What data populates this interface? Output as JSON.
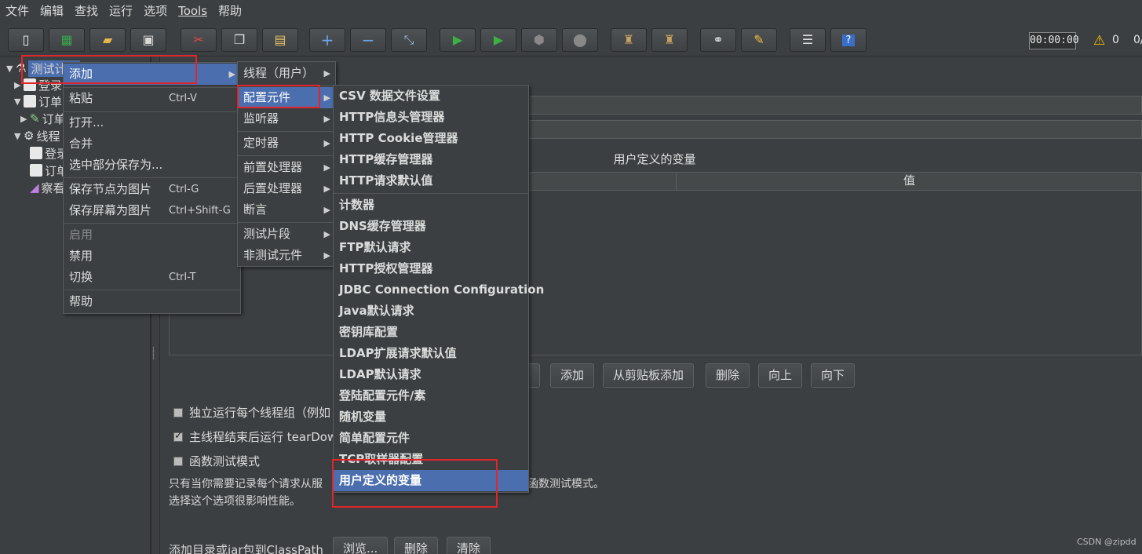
{
  "menubar": [
    "文件",
    "编辑",
    "查找",
    "运行",
    "选项",
    "Tools",
    "帮助"
  ],
  "toolbar": {
    "timer": "00:00:00",
    "warnings": "0",
    "threads": "0/"
  },
  "tree": {
    "root": "测试计划",
    "items": [
      "登录",
      "订单",
      "订单",
      "线程",
      "登录",
      "订单",
      "察看"
    ]
  },
  "context_menu": {
    "items": [
      {
        "label": "添加",
        "submenu": true
      },
      {
        "label": "粘贴",
        "shortcut": "Ctrl-V"
      },
      {
        "label": "打开..."
      },
      {
        "label": "合并"
      },
      {
        "label": "选中部分保存为..."
      },
      {
        "label": "保存节点为图片",
        "shortcut": "Ctrl-G"
      },
      {
        "label": "保存屏幕为图片",
        "shortcut": "Ctrl+Shift-G"
      },
      {
        "label": "启用"
      },
      {
        "label": "禁用"
      },
      {
        "label": "切换",
        "shortcut": "Ctrl-T"
      },
      {
        "label": "帮助"
      }
    ]
  },
  "add_submenu": {
    "items": [
      "线程（用户）",
      "配置元件",
      "监听器",
      "定时器",
      "前置处理器",
      "后置处理器",
      "断言",
      "测试片段",
      "非测试元件"
    ]
  },
  "config_submenu": {
    "items": [
      "CSV 数据文件设置",
      "HTTP信息头管理器",
      "HTTP Cookie管理器",
      "HTTP缓存管理器",
      "HTTP请求默认值",
      "计数器",
      "DNS缓存管理器",
      "FTP默认请求",
      "HTTP授权管理器",
      "JDBC Connection Configuration",
      "Java默认请求",
      "密钥库配置",
      "LDAP扩展请求默认值",
      "LDAP默认请求",
      "登陆配置元件/素",
      "随机变量",
      "简单配置元件",
      "TCP取样器配置",
      "用户定义的变量"
    ]
  },
  "main": {
    "vars_title": "用户定义的变量",
    "col_value": "值",
    "buttons": [
      "添加",
      "从剪贴板添加",
      "删除",
      "向上",
      "向下"
    ],
    "check_independent": "独立运行每个线程组（例如",
    "check_teardown": "主线程结束后运行 tearDow",
    "check_functional": "函数测试模式",
    "note1_left": "只有当你需要记录每个请求从服",
    "note1_right": "函数测试模式。",
    "note2": "选择这个选项很影响性能。",
    "classpath_label": "添加目录或jar包到ClassPath",
    "browse": "浏览...",
    "delete": "删除",
    "clear": "清除"
  },
  "watermark": "CSDN @zipdd"
}
